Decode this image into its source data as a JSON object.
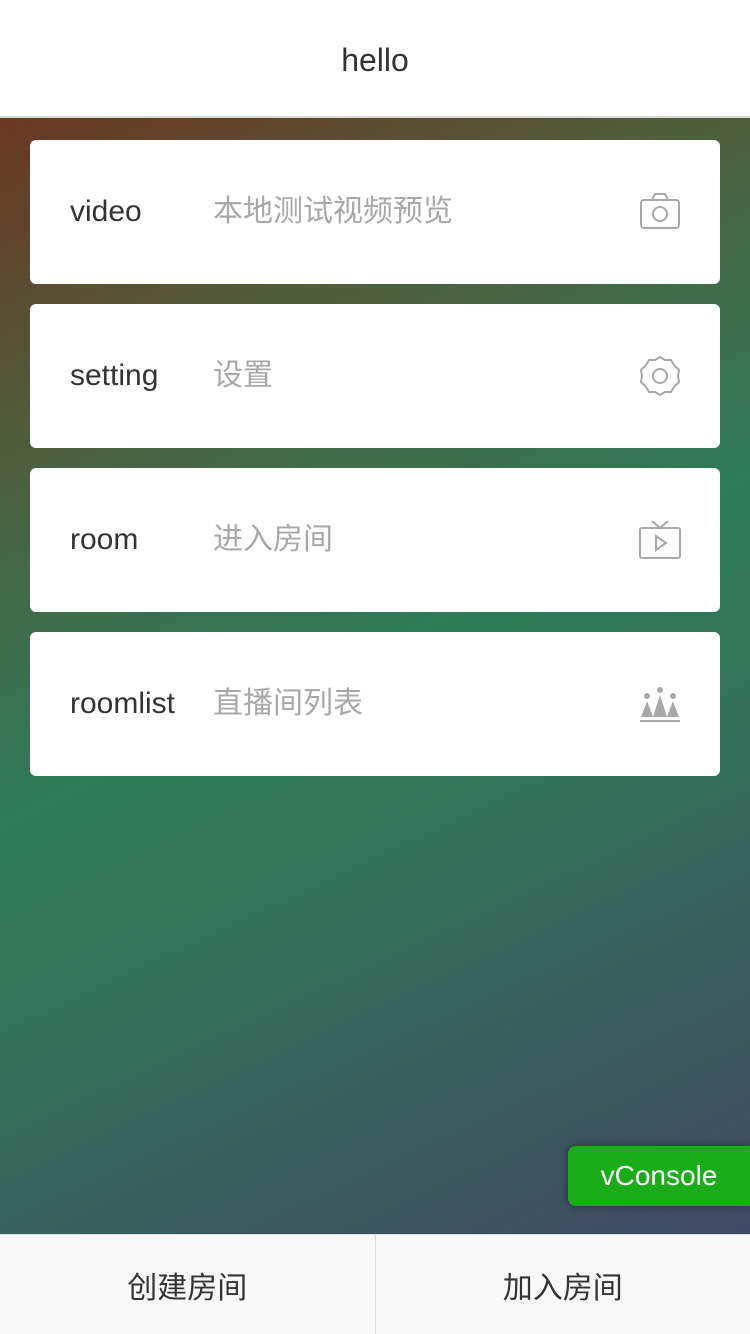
{
  "navbar": {
    "title": "hello"
  },
  "menu": {
    "items": [
      {
        "name": "video",
        "desc": "本地测试视频预览",
        "icon": "camera-icon"
      },
      {
        "name": "setting",
        "desc": "设置",
        "icon": "gear-icon"
      },
      {
        "name": "room",
        "desc": "进入房间",
        "icon": "tv-icon"
      },
      {
        "name": "roomlist",
        "desc": "直播间列表",
        "icon": "audience-icon"
      }
    ]
  },
  "vconsole": {
    "label": "vConsole"
  },
  "bottombar": {
    "create_label": "创建房间",
    "join_label": "加入房间"
  },
  "colors": {
    "icon_gray": "#a8a8a8",
    "vconsole_green": "#1aad19",
    "text_dark": "#333333"
  }
}
